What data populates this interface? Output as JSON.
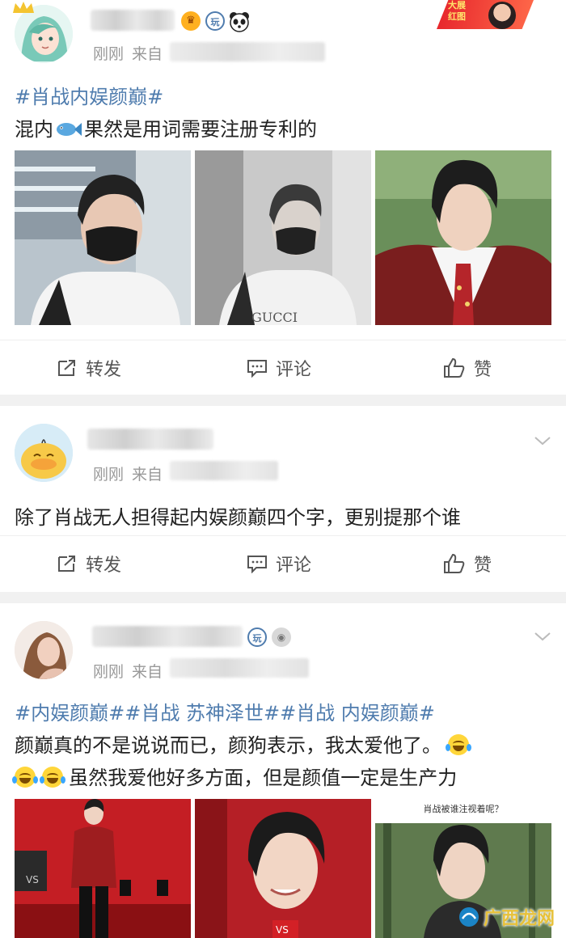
{
  "posts": [
    {
      "time": "刚刚",
      "from_label": "来自",
      "hashtags": "#肖战内娱颜巅#",
      "text_before_icon": "混内",
      "text_after_icon": "果然是用词需要注册专利的",
      "badge_label": "大展\n红图",
      "actions": {
        "repost": "转发",
        "comment": "评论",
        "like": "赞"
      }
    },
    {
      "time": "刚刚",
      "from_label": "来自",
      "text": "除了肖战无人担得起内娱颜巅四个字，更别提那个谁",
      "actions": {
        "repost": "转发",
        "comment": "评论",
        "like": "赞"
      }
    },
    {
      "time": "刚刚",
      "from_label": "来自",
      "hashtags": "#内娱颜巅##肖战 苏神泽世##肖战 内娱颜巅#",
      "text_line1": "颜巅真的不是说说而已，颜狗表示，我太爱他了。",
      "text_line2": "虽然我爱他好多方面，但是颜值一定是生产力",
      "photo3_caption": "肖战被谁注视着呢？"
    }
  ],
  "watermark": "广西龙网",
  "colors": {
    "link": "#4f7cae",
    "meta": "#999999",
    "separator": "#f1f1f1"
  },
  "icons": [
    "repost-icon",
    "comment-icon",
    "like-icon",
    "chevron-down-icon",
    "fish-emoji-icon",
    "laugh-cry-emoji-icon",
    "verified-badge-icon",
    "panda-icon",
    "crown-icon"
  ]
}
